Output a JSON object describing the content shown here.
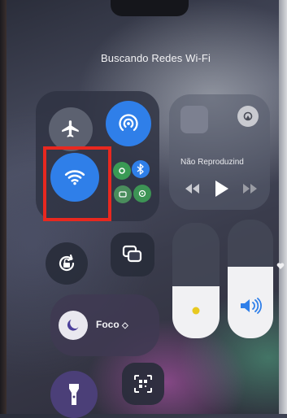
{
  "status": {
    "header": "Buscando Redes Wi-Fi"
  },
  "connectivity": {
    "airplane": {
      "icon": "airplane-icon"
    },
    "airdrop": {
      "icon": "airdrop-icon"
    },
    "wifi": {
      "icon": "wifi-icon",
      "highlighted": true
    },
    "cellular": {
      "icon": "cellular-icon"
    },
    "bluetooth": {
      "icon": "bluetooth-icon"
    },
    "hotspot": {
      "icon": "hotspot-icon"
    }
  },
  "media": {
    "now_playing": "Não Reproduzind",
    "cast_icon": "airplay-icon"
  },
  "controls": {
    "rotation_lock": {
      "icon": "rotation-lock-icon"
    },
    "screen_mirroring": {
      "icon": "screen-mirroring-icon"
    },
    "focus": {
      "label": "Foco",
      "icon": "moon-icon"
    },
    "flashlight": {
      "icon": "flashlight-icon"
    },
    "code_scanner": {
      "icon": "qr-scanner-icon"
    }
  },
  "sliders": {
    "brightness": {
      "level": 0.45,
      "icon": "sun-icon"
    },
    "volume": {
      "level": 0.6,
      "icon": "speaker-icon"
    }
  },
  "colors": {
    "accent": "#2f7fe9",
    "highlight_box": "#e8281f"
  }
}
